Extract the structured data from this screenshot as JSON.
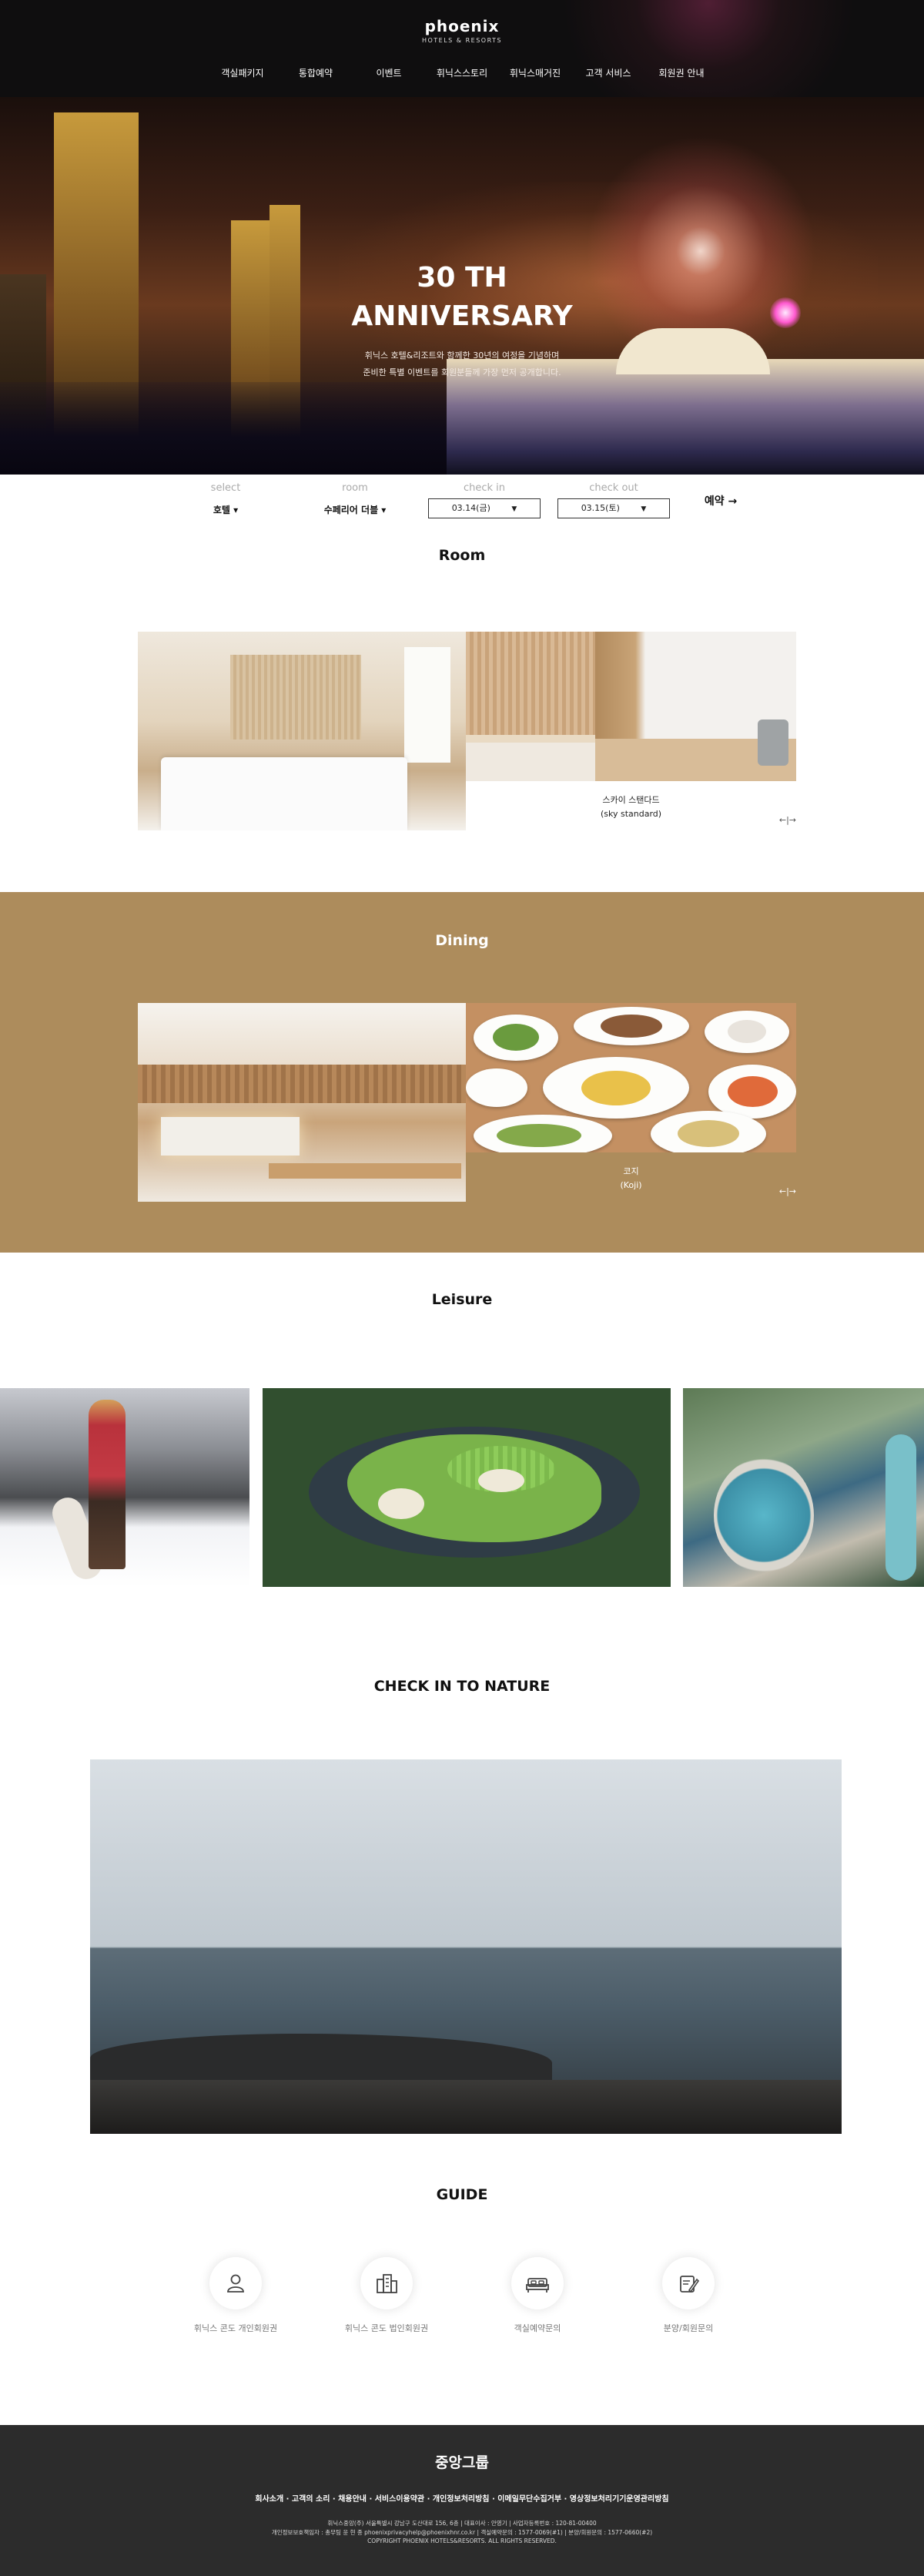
{
  "header": {
    "logo_name": "phoenix",
    "logo_sub": "HOTELS & RESORTS",
    "nav": [
      "객실패키지",
      "통합예약",
      "이벤트",
      "휘닉스스토리",
      "휘닉스매거진",
      "고객 서비스",
      "회원권 안내"
    ]
  },
  "hero": {
    "title_line1": "30 TH",
    "title_line2": "ANNIVERSARY",
    "desc_line1": "휘닉스 호텔&리조트와 함께한 30년의 여정을 기념하며",
    "desc_line2": "준비한 특별 이벤트를 회원분들께 가장 먼저 공개합니다."
  },
  "booking": {
    "select_label": "select",
    "select_value": "호텔 ▾",
    "room_label": "room",
    "room_value": "수페리어 더블 ▾",
    "checkin_label": "check in",
    "checkin_value": "03.14(금)",
    "checkout_label": "check out",
    "checkout_value": "03.15(토)",
    "dropdown_arrow": "▼",
    "reserve_label": "예약 →"
  },
  "room": {
    "title": "Room",
    "caption_line1": "스카이 스탠다드",
    "caption_line2": "(sky standard)",
    "arrows": "←|→"
  },
  "dining": {
    "title": "Dining",
    "caption_line1": "코지",
    "caption_line2": "(Koji)",
    "arrows": "←|→"
  },
  "leisure": {
    "title": "Leisure"
  },
  "nature": {
    "title": "CHECK IN TO NATURE"
  },
  "guide": {
    "title": "GUIDE",
    "items": [
      {
        "label": "휘닉스 콘도 개인회원권",
        "icon": "person-icon"
      },
      {
        "label": "휘닉스 콘도 법인회원권",
        "icon": "building-icon"
      },
      {
        "label": "객실예약문의",
        "icon": "bed-icon"
      },
      {
        "label": "분양/회원문의",
        "icon": "document-edit-icon"
      }
    ]
  },
  "footer": {
    "company": "중앙그룹",
    "links": "회사소개 · 고객의 소리 · 채용안내 · 서비스이용약관 · 개인정보처리방침 · 이메일무단수집거부 · 영상정보처리기기운영관리방침",
    "info_line1": "휘닉스중앙(주) 서울특별시 강남구 도산대로 156, 6층 | 대표이사 : 안영기 | 사업자등록번호 : 120-81-00400",
    "info_line2": "개인정보보호책임자 : 총무팀 윤 현 종 phoenixprivacyhelp@phoenixhnr.co.kr | 객실예약문의 : 1577-0069(#1) | 분양/회원문의 : 1577-0660(#2)",
    "info_line3": "COPYRIGHT PHOENIX HOTELS&RESORTS. ALL RIGHTS RESERVED."
  },
  "colors": {
    "dining_bg": "#ad8c5c",
    "footer_bg": "#2c2c2c",
    "header_bg": "#0f0e0f"
  }
}
